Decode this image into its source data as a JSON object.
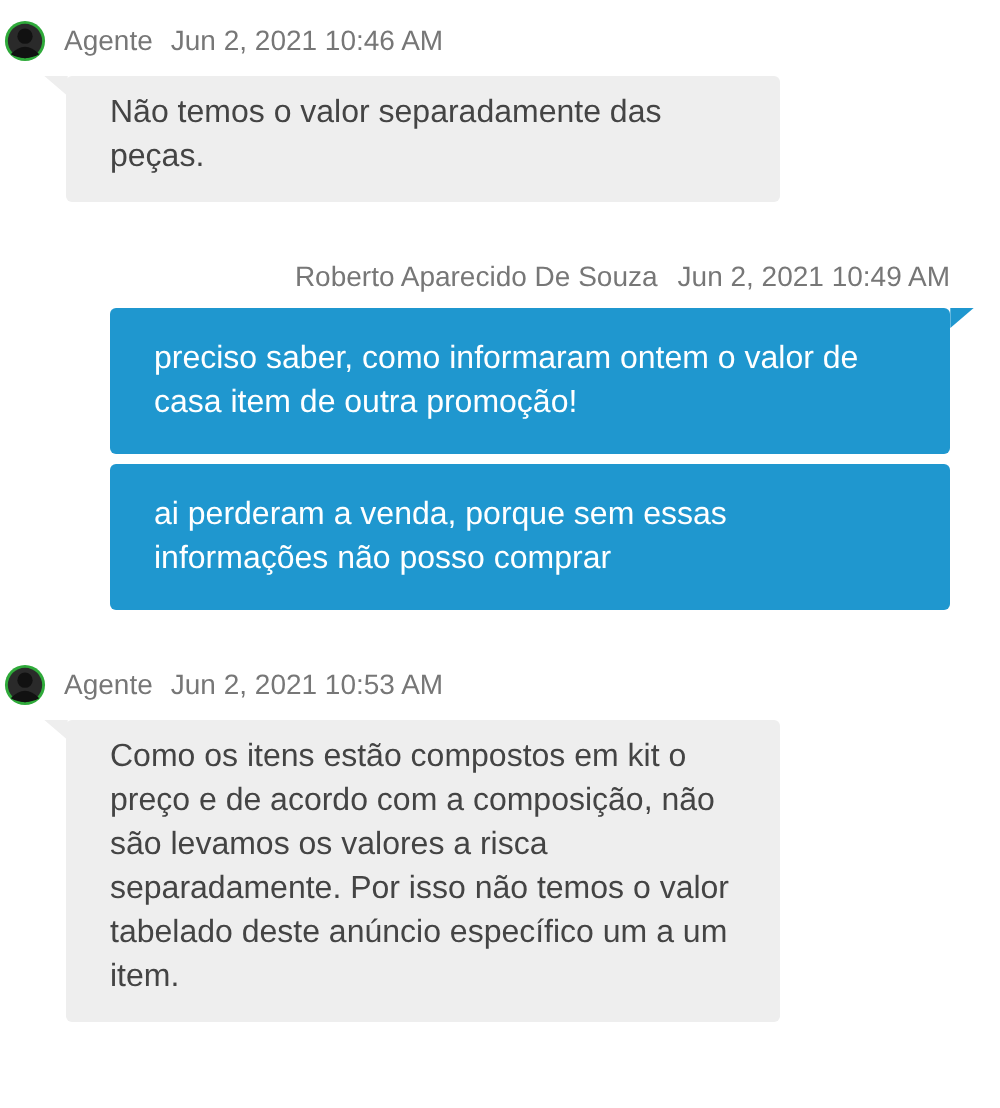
{
  "messages": [
    {
      "kind": "agent",
      "sender": "Agente",
      "time": "Jun 2, 2021 10:46 AM",
      "bubbles": [
        "Não temos o valor separadamente das peças."
      ]
    },
    {
      "kind": "user",
      "sender": "Roberto Aparecido De Souza",
      "time": "Jun 2, 2021 10:49 AM",
      "bubbles": [
        "preciso saber, como informaram ontem o valor de casa item de outra promoção!",
        "ai perderam a venda, porque sem essas informações não posso comprar"
      ]
    },
    {
      "kind": "agent",
      "sender": "Agente",
      "time": "Jun 2, 2021 10:53 AM",
      "bubbles": [
        "Como os itens estão compostos em kit o preço e de acordo com a composição, não são levamos os valores a risca separadamente. Por isso não temos o valor tabelado deste anúncio específico um a um item."
      ]
    }
  ]
}
